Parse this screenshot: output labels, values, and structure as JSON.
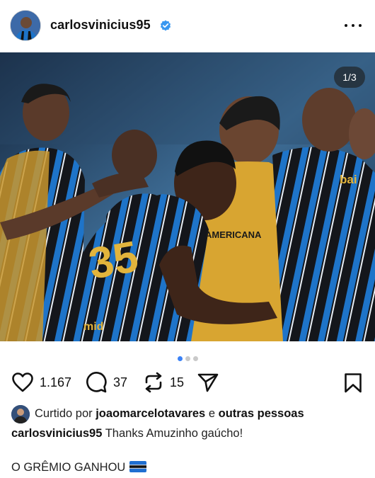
{
  "post": {
    "username": "carlosvinicius95",
    "verified": true,
    "more_icon": "more-horizontal-icon",
    "image_counter": "1/3",
    "carousel": {
      "total": 3,
      "active": 1
    },
    "actions": {
      "likes": "1.167",
      "comments": "37",
      "reposts": "15"
    },
    "liked_by": {
      "prefix": "Curtido por",
      "user": "joaomarcelotavares",
      "connector": "e",
      "others": "outras pessoas"
    },
    "caption": {
      "username": "carlosvinicius95",
      "text": "Thanks Amuzinho gaúcho!"
    },
    "caption_line2": "O GRÊMIO GANHOU",
    "colors": {
      "accent_dot": "#3b82f6",
      "verified": "#3897f0",
      "jersey_blue": "#1e74c9",
      "jersey_black": "#14161b",
      "bib_yellow": "#d8a531"
    }
  }
}
